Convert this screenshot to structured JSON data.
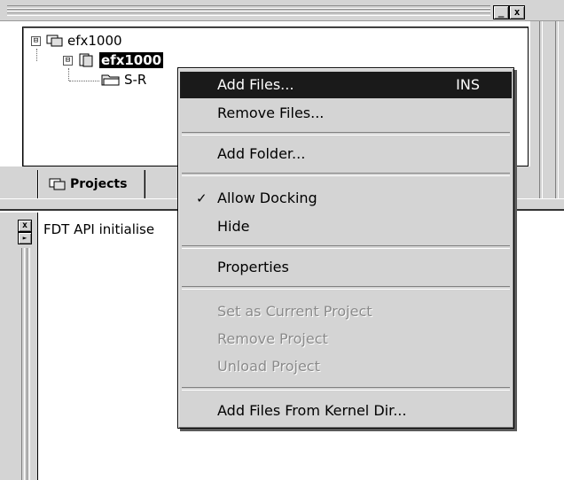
{
  "title_buttons": [
    "_",
    "x"
  ],
  "tree": {
    "root": {
      "expander": "⊟",
      "label": "efx1000",
      "icon": "workspace-icon"
    },
    "child": {
      "expander": "⊟",
      "label": "efx1000",
      "icon": "project-icon"
    },
    "grandchild": {
      "label": "S-R",
      "icon": "folder-icon"
    }
  },
  "tabs": [
    {
      "label": "Projects",
      "icon": "projects-icon"
    }
  ],
  "output": {
    "text": "FDT API initialise",
    "close_glyph": "x",
    "arrow_glyph": "►"
  },
  "context_menu": {
    "items": [
      {
        "label": "Add Files...",
        "shortcut": "INS",
        "state": "highlighted"
      },
      {
        "label": "Remove Files...",
        "state": "enabled"
      },
      {
        "label": "Add Folder...",
        "state": "enabled"
      },
      {
        "label": "Allow Docking",
        "checked": true,
        "state": "enabled"
      },
      {
        "label": "Hide",
        "state": "enabled"
      },
      {
        "label": "Properties",
        "state": "enabled"
      },
      {
        "label": "Set as Current Project",
        "state": "disabled"
      },
      {
        "label": "Remove Project",
        "state": "disabled"
      },
      {
        "label": "Unload Project",
        "state": "disabled"
      },
      {
        "label": "Add Files From Kernel Dir...",
        "state": "enabled"
      }
    ],
    "check_glyph": "✓"
  },
  "colors": {
    "highlight": "#1a1a1a",
    "panel": "#d4d4d4",
    "disabled_text": "#8a8a8a"
  }
}
